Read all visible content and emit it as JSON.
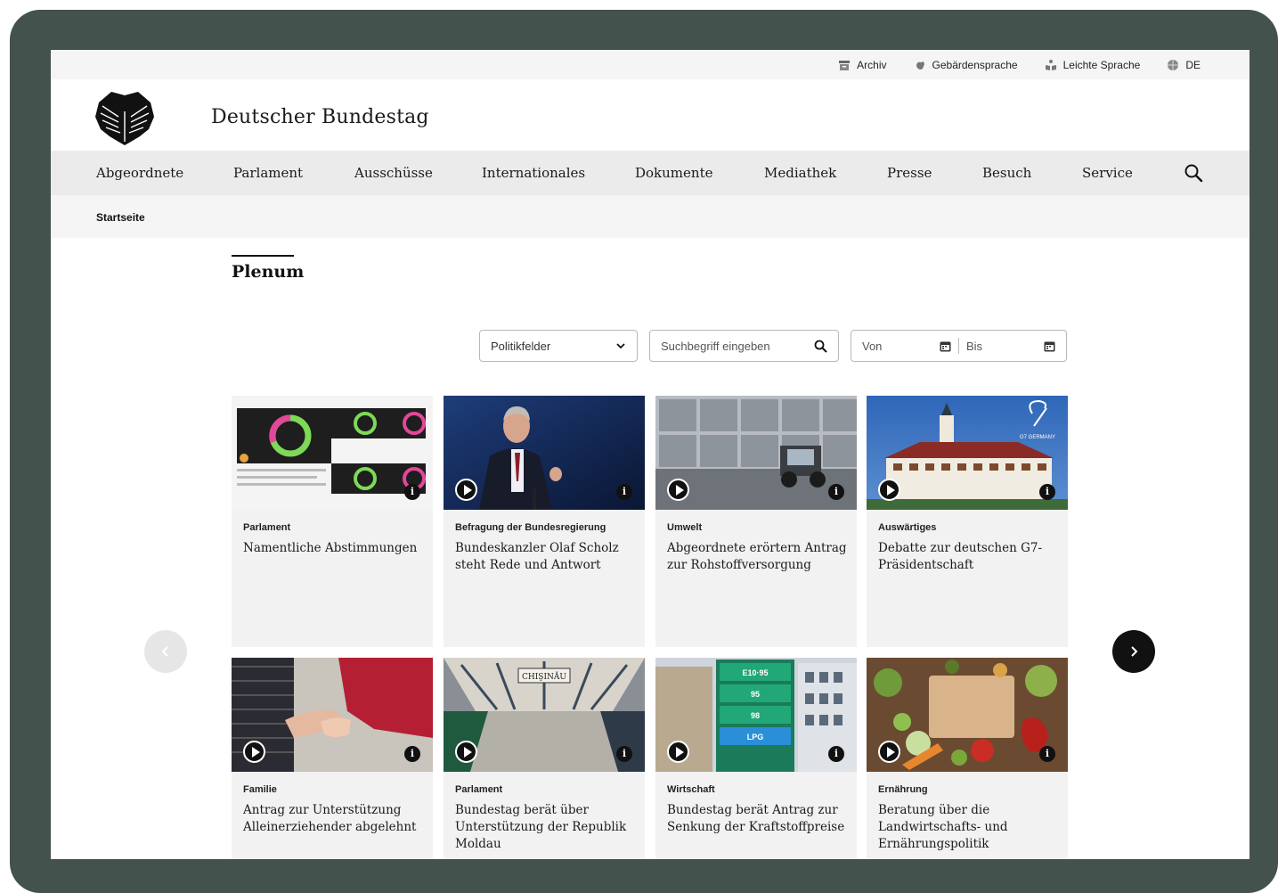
{
  "utility_bar": {
    "archive_label": "Archiv",
    "sign_language_label": "Gebärdensprache",
    "easy_language_label": "Leichte Sprache",
    "language_label": "DE"
  },
  "header": {
    "site_title": "Deutscher Bundestag"
  },
  "nav": {
    "items": [
      {
        "label": "Abgeordnete"
      },
      {
        "label": "Parlament"
      },
      {
        "label": "Ausschüsse"
      },
      {
        "label": "Internationales"
      },
      {
        "label": "Dokumente"
      },
      {
        "label": "Mediathek"
      },
      {
        "label": "Presse"
      },
      {
        "label": "Besuch"
      },
      {
        "label": "Service"
      }
    ]
  },
  "breadcrumb": {
    "home": "Startseite"
  },
  "page": {
    "heading": "Plenum"
  },
  "filters": {
    "topic_select": "Politikfelder",
    "search_placeholder": "Suchbegriff eingeben",
    "from_placeholder": "Von",
    "to_placeholder": "Bis"
  },
  "cards": [
    {
      "category": "Parlament",
      "title": "Namentliche Abstimmungen"
    },
    {
      "category": "Befragung der Bundesregierung",
      "title": "Bundeskanzler Olaf Scholz steht Rede und Antwort"
    },
    {
      "category": "Umwelt",
      "title": "Abgeordnete erörtern Antrag zur Rohstoffversorgung"
    },
    {
      "category": "Auswärtiges",
      "title": "Debatte zur deutschen G7-Präsidentschaft"
    },
    {
      "category": "Familie",
      "title": "Antrag zur Unterstützung Alleinerziehender abgelehnt"
    },
    {
      "category": "Parlament",
      "title": "Bundestag berät über Unterstützung der Republik Moldau"
    },
    {
      "category": "Wirtschaft",
      "title": "Bundestag berät Antrag zur Senkung der Kraftstoffpreise"
    },
    {
      "category": "Ernährung",
      "title": "Beratung über die Landwirtschafts- und Ernährungspolitik"
    }
  ],
  "image_text": {
    "g7_logo": "G7 GERMANY",
    "station_sign": "CHIŞINĂU",
    "fuel_signs": [
      "E10·95",
      "95",
      "98",
      "LPG"
    ]
  },
  "colors": {
    "bezel": "#44524e",
    "nav_bg": "#ebebeb",
    "card_bg": "#f2f2f2"
  }
}
